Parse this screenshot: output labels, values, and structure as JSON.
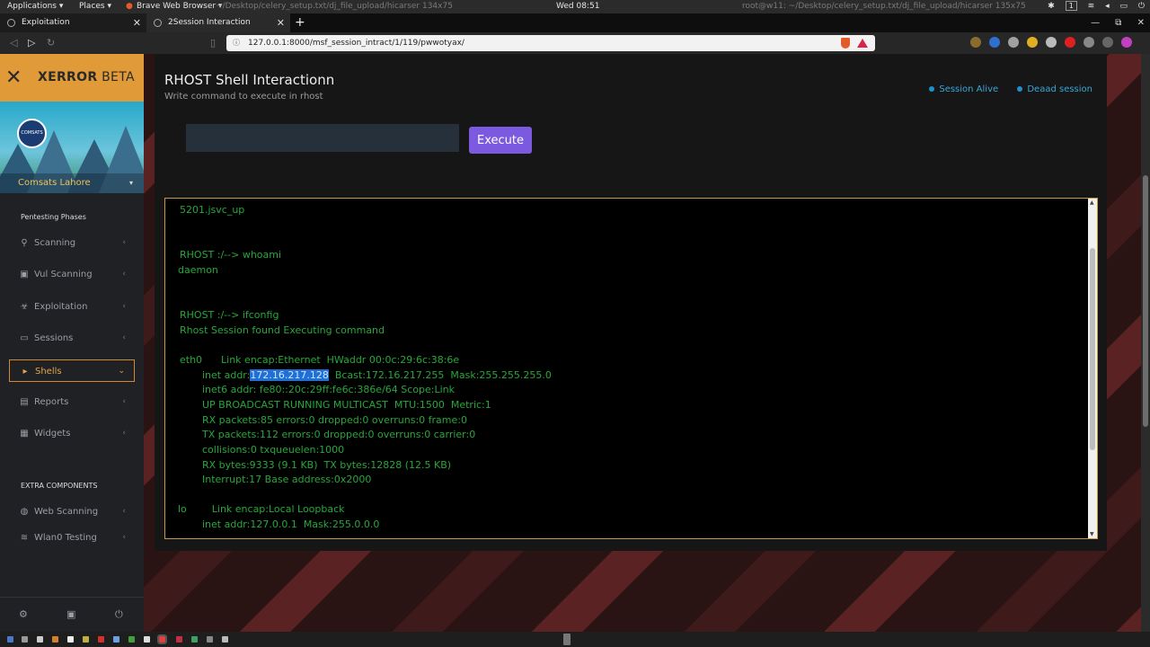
{
  "os": {
    "applications": "Applications ▾",
    "places": "Places ▾",
    "browser": "Brave Web Browser ▾",
    "path_left": "~/Desktop/celery_setup.txt/dj_file_upload/hicarser 134x75",
    "clock": "Wed 08:51",
    "path_right": "root@w11: ~/Desktop/celery_setup.txt/dj_file_upload/hicarser 135x75",
    "workspace": "1"
  },
  "tabs": [
    {
      "label": "Exploitation"
    },
    {
      "label": "2Session Interaction"
    }
  ],
  "url": "127.0.0.1:8000/msf_session_intract/1/119/pwwotyax/",
  "brand": {
    "name": "XERROR",
    "suffix": " BETA"
  },
  "profile": {
    "org": "Comsats Lahore",
    "avatar_text": "COMSATS"
  },
  "sidebar": {
    "section_title": "Pentesting Phases",
    "items": [
      {
        "label": "Scanning"
      },
      {
        "label": "Vul Scanning"
      },
      {
        "label": "Exploitation"
      },
      {
        "label": "Sessions"
      },
      {
        "label": "Shells"
      },
      {
        "label": "Reports"
      },
      {
        "label": "Widgets"
      }
    ],
    "extra_title": "EXTRA COMPONENTS",
    "extra_items": [
      {
        "label": "Web Scanning"
      },
      {
        "label": "Wlan0 Testing"
      }
    ]
  },
  "page": {
    "title": "RHOST Shell Interactionn",
    "subtitle": "Write command to execute in rhost",
    "legend_alive": "Session Alive",
    "legend_dead": "Deaad session",
    "input_value": "",
    "execute_label": "Execute"
  },
  "terminal": {
    "lines": [
      "5201.jsvc_up",
      "RHOST :/--> whoami",
      "daemon",
      "RHOST :/--> ifconfig",
      "Rhost Session found Executing command",
      "eth0      Link encap:Ethernet  HWaddr 00:0c:29:6c:38:6e",
      "inet addr:",
      "172.16.217.128",
      "  Bcast:172.16.217.255  Mask:255.255.255.0",
      "inet6 addr: fe80::20c:29ff:fe6c:386e/64 Scope:Link",
      "UP BROADCAST RUNNING MULTICAST  MTU:1500  Metric:1",
      "RX packets:85 errors:0 dropped:0 overruns:0 frame:0",
      "TX packets:112 errors:0 dropped:0 overruns:0 carrier:0",
      "collisions:0 txqueuelen:1000",
      "RX bytes:9333 (9.1 KB)  TX bytes:12828 (12.5 KB)",
      "Interrupt:17 Base address:0x2000",
      "lo        Link encap:Local Loopback",
      "inet addr:127.0.0.1  Mask:255.0.0.0"
    ]
  },
  "colors": {
    "accent_orange": "#e09a38",
    "execute_purple": "#7b5ae0",
    "terminal_green": "#27a83a",
    "legend_blue": "#3aa7d6"
  }
}
